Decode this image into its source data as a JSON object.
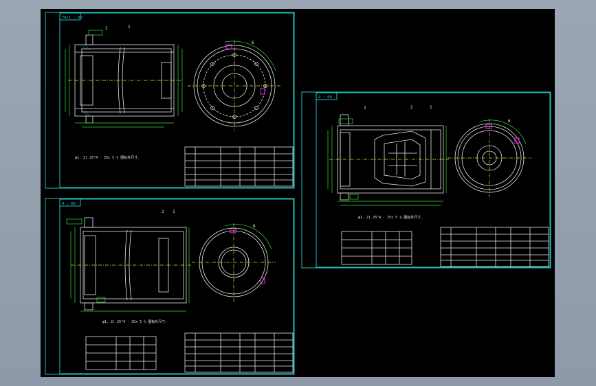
{
  "sheets": [
    {
      "id": "sheet-1",
      "tag": "Y4/1 : 60",
      "note": "φ1. 2) 25°4 · 25x 5 ½ 圈标外尺寸.",
      "balloons": [
        "2",
        "1",
        "6"
      ]
    },
    {
      "id": "sheet-2",
      "tag": "4 : 60",
      "note": "φ1. 2) 25°4 · 25x 5 ½ 圈标外尺寸.",
      "balloons": [
        "2",
        "1",
        "6"
      ]
    },
    {
      "id": "sheet-3",
      "tag": "4 : 60",
      "note": "φ1. 2) 25°4 · 25x 5 ½ 圈标外尺寸.",
      "balloons": [
        "2",
        "2",
        "1",
        "6"
      ]
    }
  ],
  "colors": {
    "background": "#8e9aa9",
    "viewport": "#000000",
    "border": "#22d3d3",
    "geometry": "#e8e8e8",
    "centerline": "#e6e62a",
    "dimension": "#33dd33",
    "highlight": "#ee22ee"
  }
}
